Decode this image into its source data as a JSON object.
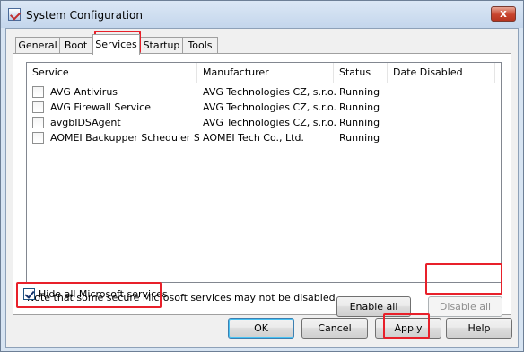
{
  "window": {
    "title": "System Configuration",
    "close_glyph": "x"
  },
  "tabs": [
    {
      "label": "General"
    },
    {
      "label": "Boot"
    },
    {
      "label": "Services",
      "active": true
    },
    {
      "label": "Startup"
    },
    {
      "label": "Tools"
    }
  ],
  "services": {
    "columns": [
      "Service",
      "Manufacturer",
      "Status",
      "Date Disabled"
    ],
    "rows": [
      {
        "service": "AVG Antivirus",
        "manufacturer": "AVG Technologies CZ, s.r.o.",
        "status": "Running",
        "date_disabled": "",
        "checked": false
      },
      {
        "service": "AVG Firewall Service",
        "manufacturer": "AVG Technologies CZ, s.r.o.",
        "status": "Running",
        "date_disabled": "",
        "checked": false
      },
      {
        "service": "avgbIDSAgent",
        "manufacturer": "AVG Technologies CZ, s.r.o.",
        "status": "Running",
        "date_disabled": "",
        "checked": false
      },
      {
        "service": "AOMEI Backupper Scheduler Ser...",
        "manufacturer": "AOMEI Tech Co., Ltd.",
        "status": "Running",
        "date_disabled": "",
        "checked": false
      }
    ]
  },
  "note": "Note that some secure Microsoft services may not be disabled.",
  "buttons": {
    "enable_all": "Enable all",
    "disable_all": "Disable all",
    "ok": "OK",
    "cancel": "Cancel",
    "apply": "Apply",
    "help": "Help"
  },
  "hide_ms": {
    "label": "Hide all Microsoft services",
    "checked": true
  },
  "colors": {
    "highlight": "#e8202a",
    "window_frame": "#d7e4f2"
  }
}
